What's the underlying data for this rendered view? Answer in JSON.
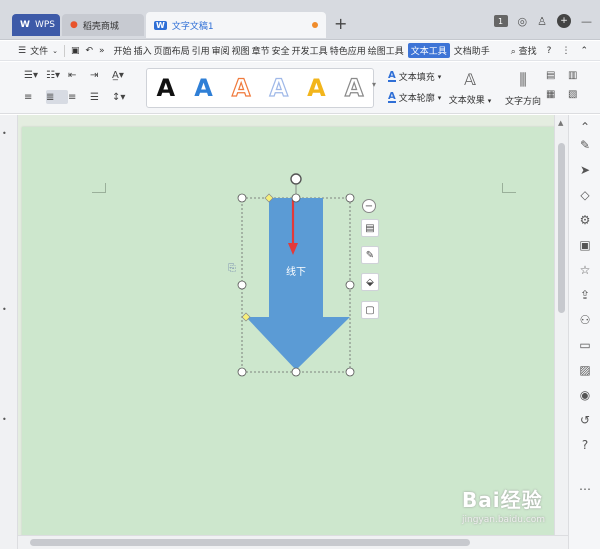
{
  "tabs": {
    "wps": "WPS",
    "store": "稻壳商城",
    "doc": "文字文稿1",
    "new_tab": "+"
  },
  "window": {
    "page_badge": "1"
  },
  "menubar": {
    "file": "文件",
    "items": [
      "开始",
      "插入",
      "页面布局",
      "引用",
      "审阅",
      "视图",
      "章节",
      "安全",
      "开发工具",
      "特色应用",
      "绘图工具",
      "文本工具",
      "文档助手"
    ],
    "active": "文本工具",
    "search": "查找"
  },
  "ribbon": {
    "style_letters": [
      "A",
      "A",
      "A",
      "A",
      "A",
      "A"
    ],
    "style_colors": [
      "#111111",
      "#2f7fd6",
      "#f07a3c",
      "#9fb8e8",
      "#f2b51c",
      "#8a8a8a"
    ],
    "text_fill": "文本填充",
    "text_outline": "文本轮廓",
    "text_effect": "文本效果",
    "text_direction": "文字方向"
  },
  "shape": {
    "label": "线下",
    "fill": "#5b9bd5",
    "arrow_color": "#e23a3a"
  },
  "watermark": {
    "brand": "Bai经验",
    "site": "jingyan.baidu.com"
  }
}
